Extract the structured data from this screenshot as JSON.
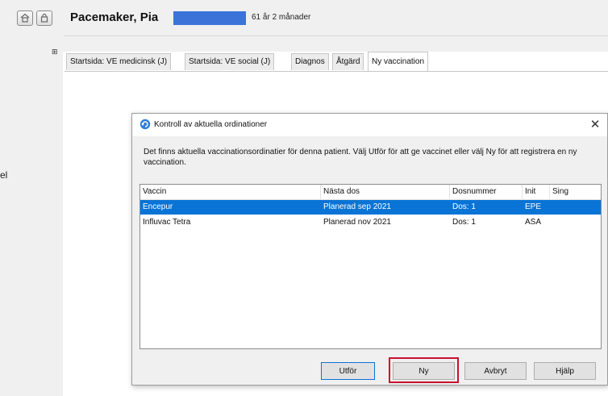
{
  "window": {
    "left_fragment": "el"
  },
  "header": {
    "patient_name": "Pacemaker, Pia",
    "age": "61 år 2 månader",
    "icons": [
      "home-icon",
      "lock-icon"
    ]
  },
  "tabs": [
    {
      "label": "Startsida: VE medicinsk (J)",
      "active": false
    },
    {
      "label": "Startsida: VE social (J)",
      "active": false
    },
    {
      "label": "Diagnos",
      "active": false
    },
    {
      "label": "Åtgärd",
      "active": false
    },
    {
      "label": "Ny vaccination",
      "active": true
    }
  ],
  "dialog": {
    "title": "Kontroll av aktuella ordinationer",
    "icon": "refresh-icon",
    "close_label": "✕",
    "message": "Det finns aktuella vaccinationsordinatier för denna patient. Välj Utför för att ge vaccinet eller välj Ny för att registrera en ny vaccination.",
    "columns": [
      "Vaccin",
      "Nästa dos",
      "Dosnummer",
      "Init",
      "Sing"
    ],
    "rows": [
      {
        "vaccin": "Encepur",
        "nasta_dos": "Planerad sep 2021",
        "dosnummer": "Dos: 1",
        "init": "EPE",
        "sing": "",
        "selected": true
      },
      {
        "vaccin": "Influvac Tetra",
        "nasta_dos": "Planerad nov 2021",
        "dosnummer": "Dos: 1",
        "init": "ASA",
        "sing": "",
        "selected": false
      }
    ],
    "buttons": {
      "execute": "Utför",
      "new": "Ny",
      "cancel": "Avbryt",
      "help": "Hjälp"
    }
  },
  "colors": {
    "selection": "#0a74d6",
    "patient_id_box": "#3b73d9",
    "highlight_frame": "#c8102e"
  }
}
